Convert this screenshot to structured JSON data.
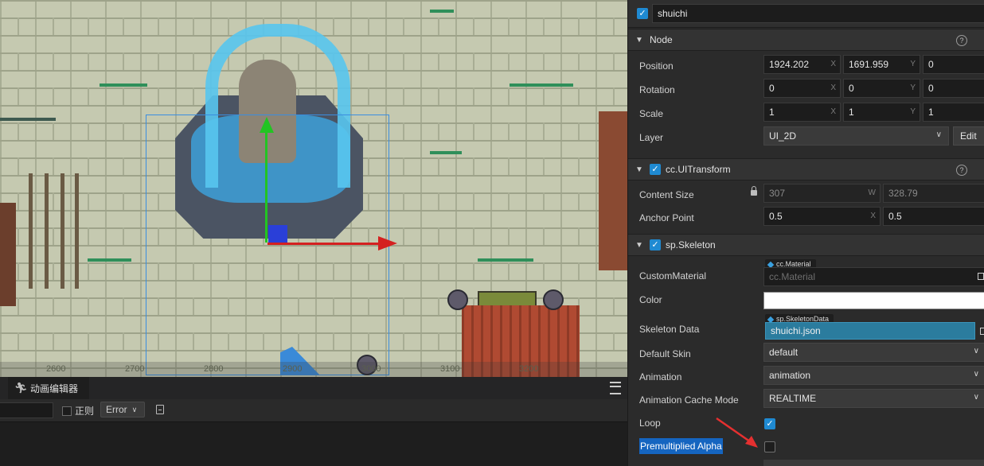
{
  "scene": {
    "ruler_ticks": [
      "2600",
      "2700",
      "2800",
      "2900",
      "3000",
      "3100",
      "3200"
    ]
  },
  "bottom_panel": {
    "tab_label": "动画编辑器",
    "regex_label": "正则",
    "level_value": "Error"
  },
  "inspector": {
    "node_name": "shuichi",
    "node_section": {
      "title": "Node",
      "position": {
        "label": "Position",
        "x": "1924.202",
        "y": "1691.959",
        "z": "0"
      },
      "rotation": {
        "label": "Rotation",
        "x": "0",
        "y": "0",
        "z": "0"
      },
      "scale": {
        "label": "Scale",
        "x": "1",
        "y": "1",
        "z": "1"
      },
      "layer": {
        "label": "Layer",
        "value": "UI_2D",
        "edit_label": "Edit"
      }
    },
    "uitransform": {
      "title": "cc.UITransform",
      "content_size": {
        "label": "Content Size",
        "w": "307",
        "h": "328.79"
      },
      "anchor_point": {
        "label": "Anchor Point",
        "x": "0.5",
        "y": "0.5"
      }
    },
    "skeleton": {
      "title": "sp.Skeleton",
      "custom_material": {
        "label": "CustomMaterial",
        "tag": "cc.Material",
        "placeholder": "cc.Material"
      },
      "color": {
        "label": "Color",
        "value": "#ffffff"
      },
      "skeleton_data": {
        "label": "Skeleton Data",
        "tag": "sp.SkeletonData",
        "value": "shuichi.json"
      },
      "default_skin": {
        "label": "Default Skin",
        "value": "default"
      },
      "animation": {
        "label": "Animation",
        "value": "animation"
      },
      "animation_cache_mode": {
        "label": "Animation Cache Mode",
        "value": "REALTIME"
      },
      "loop": {
        "label": "Loop",
        "checked": true
      },
      "premultiplied_alpha": {
        "label": "Premultiplied Alpha",
        "checked": false
      }
    },
    "axis_letters": {
      "x": "X",
      "y": "Y",
      "w": "W"
    }
  },
  "colors": {
    "accent": "#1f8ad2",
    "highlight": "#1565c0",
    "annotation_arrow": "#e53030"
  }
}
